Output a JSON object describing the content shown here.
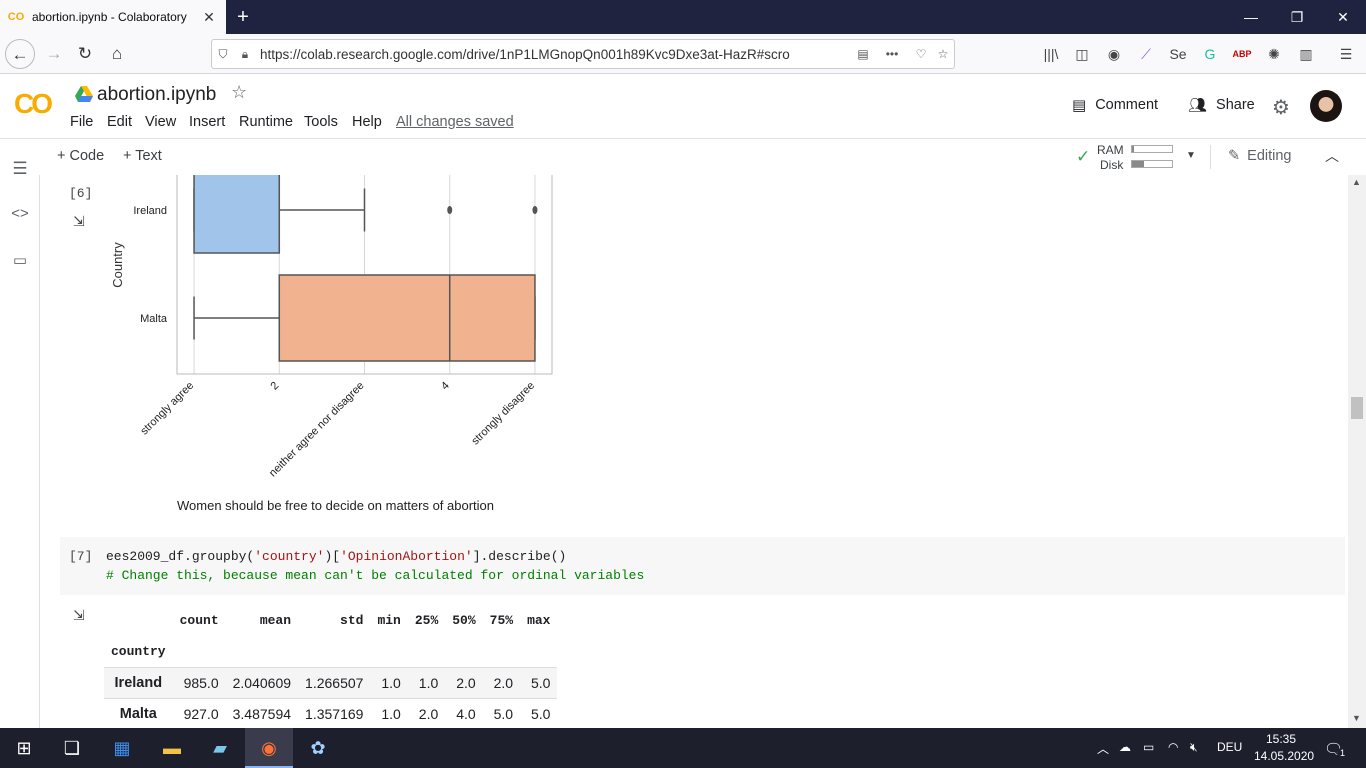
{
  "browser": {
    "tab_title": "abortion.ipynb - Colaboratory",
    "tab_favicon": "CO",
    "url": "https://colab.research.google.com/drive/1nP1LMGnopQn001h89Kvc9Dxe3at-HazR#scro",
    "win_min": "—",
    "win_max": "❐",
    "win_close": "✕"
  },
  "colab": {
    "logo": "CO",
    "notebook_title": "abortion.ipynb",
    "menu": [
      "File",
      "Edit",
      "View",
      "Insert",
      "Runtime",
      "Tools",
      "Help"
    ],
    "save_status": "All changes saved",
    "comment_label": "Comment",
    "share_label": "Share",
    "toolbar": {
      "add_code": "+ Code",
      "add_text": "+ Text",
      "ram_label": "RAM",
      "disk_label": "Disk",
      "ram_usage": 0.05,
      "disk_usage": 0.3,
      "editing_label": "Editing"
    }
  },
  "cells": {
    "cell6": {
      "exec_count": "[6]",
      "chart_data": {
        "type": "boxplot",
        "orientation": "horizontal",
        "categories": [
          "Ireland",
          "Malta"
        ],
        "ylabel": "Country",
        "xlabel": "Women should be free to decide on matters of abortion",
        "xticks": [
          {
            "value": 1,
            "label": "strongly agree"
          },
          {
            "value": 2,
            "label": "2"
          },
          {
            "value": 3,
            "label": "neither agree nor disagree"
          },
          {
            "value": 4,
            "label": "4"
          },
          {
            "value": 5,
            "label": "strongly disagree"
          }
        ],
        "xlim": [
          0.8,
          5.2
        ],
        "series": [
          {
            "name": "Ireland",
            "whisker_low": 1.0,
            "q1": 1.0,
            "median": 2.0,
            "q3": 2.0,
            "whisker_high": 3.0,
            "outliers": [
              4.0,
              5.0
            ],
            "color": "#a1c4ea"
          },
          {
            "name": "Malta",
            "whisker_low": 1.0,
            "q1": 2.0,
            "median": 4.0,
            "q3": 5.0,
            "whisker_high": 5.0,
            "outliers": [],
            "color": "#f0b28f"
          }
        ]
      }
    },
    "cell7": {
      "exec_count": "[7]",
      "code_line1_a": "ees2009_df.groupby(",
      "code_line1_s1": "'country'",
      "code_line1_b": ")[",
      "code_line1_s2": "'OpinionAbortion'",
      "code_line1_c": "].describe()",
      "code_line2": "# Change this, because mean can't be calculated for ordinal variables",
      "table": {
        "columns": [
          "count",
          "mean",
          "std",
          "min",
          "25%",
          "50%",
          "75%",
          "max"
        ],
        "index_name": "country",
        "rows": [
          {
            "label": "Ireland",
            "values": [
              "985.0",
              "2.040609",
              "1.266507",
              "1.0",
              "1.0",
              "2.0",
              "2.0",
              "5.0"
            ]
          },
          {
            "label": "Malta",
            "values": [
              "927.0",
              "3.487594",
              "1.357169",
              "1.0",
              "2.0",
              "4.0",
              "5.0",
              "5.0"
            ]
          }
        ]
      }
    }
  },
  "taskbar": {
    "language": "DEU",
    "time": "15:35",
    "date": "14.05.2020",
    "notification_count": "1"
  }
}
